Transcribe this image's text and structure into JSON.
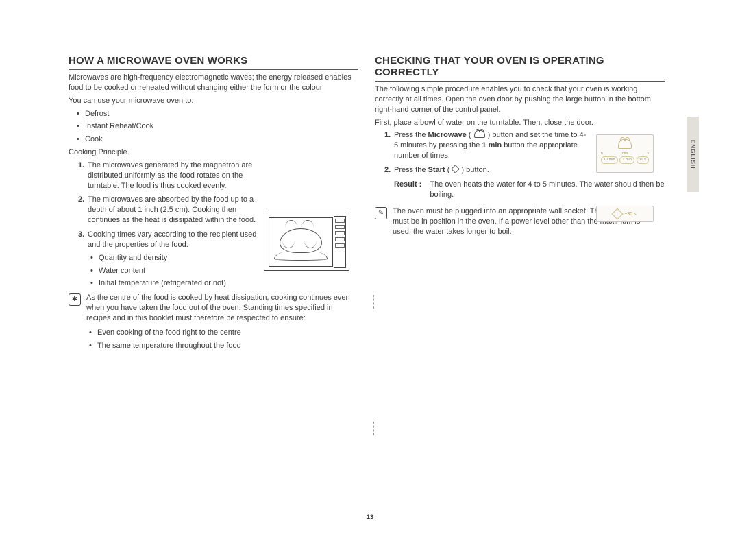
{
  "language_tab": "ENGLISH",
  "page_number": "13",
  "left": {
    "heading": "HOW A MICROWAVE OVEN WORKS",
    "intro": "Microwaves are high-frequency electromagnetic waves; the energy released enables food to be cooked or reheated without changing either the form or the colour.",
    "uses_lead": "You can use your microwave oven to:",
    "uses": [
      "Defrost",
      "Instant Reheat/Cook",
      "Cook"
    ],
    "principle_label": "Cooking Principle.",
    "steps": [
      "The microwaves generated by the magnetron are distributed uniformly as the food rotates on the turntable. The food is thus cooked evenly.",
      "The microwaves are absorbed by the food up to a depth of about 1 inch (2.5 cm). Cooking then continues as the heat is dissipated within the food.",
      "Cooking times vary according to the recipient used and the properties of the food:"
    ],
    "step3_bullets": [
      "Quantity and density",
      "Water content",
      "Initial temperature (refrigerated or not)"
    ],
    "note": "As the centre of the food is cooked by heat dissipation, cooking continues even when you have taken the food out of the oven. Standing times specified in recipes and in this booklet must therefore be respected to ensure:",
    "note_bullets": [
      "Even cooking of the food right to the centre",
      "The same temperature throughout the food"
    ]
  },
  "right": {
    "heading": "CHECKING THAT YOUR OVEN IS OPERATING CORRECTLY",
    "intro1": "The following simple procedure enables you to check that your oven is working correctly at all times. Open the oven door by pushing the large button in the bottom right-hand corner of the control panel.",
    "intro2": "First, place a bowl of water on the turntable. Then, close the door.",
    "step1_a": "Press the ",
    "step1_bold": "Microwave",
    "step1_b": " ( ",
    "step1_c": " ) button and set the time to 4-5 minutes by pressing the ",
    "step1_bold2": "1 min",
    "step1_d": " button the appropriate number of times.",
    "step2_a": "Press the ",
    "step2_bold": "Start",
    "step2_b": " ( ",
    "step2_c": " ) button.",
    "result_label": "Result :",
    "result_text": "The oven heats the water for 4 to 5 minutes. The water should then be boiling.",
    "note": "The oven must be plugged into an appropriate wall socket. The turntable must be in position in the oven. If a power level other than the maximum is used, the water takes longer to boil.",
    "panel": {
      "h": "h",
      "min": "min",
      "s": "s",
      "h_val": "10 min",
      "min_val": "1 min",
      "s_val": "10 s",
      "start": "+30 s"
    }
  }
}
